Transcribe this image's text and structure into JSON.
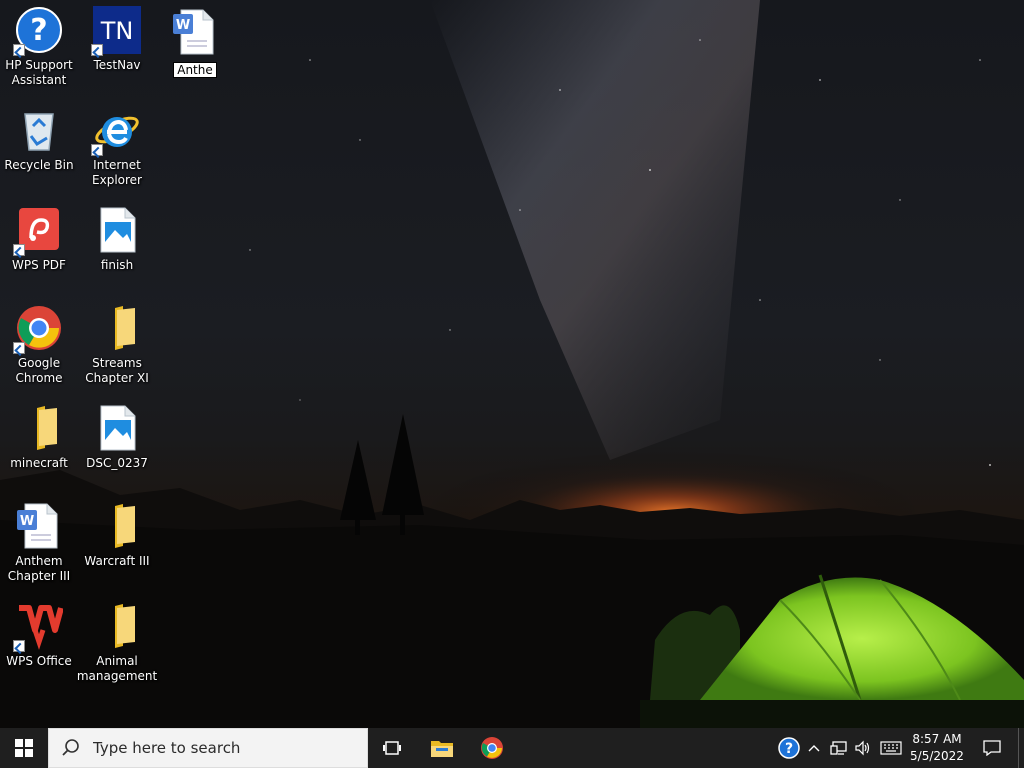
{
  "desktop": {
    "icons": [
      {
        "label": "HP Support\nAssistant",
        "icon": "hp-support-icon"
      },
      {
        "label": "TestNav",
        "icon": "testnav-icon",
        "badge": "TN"
      },
      {
        "label": "Recycle Bin",
        "icon": "recycle-bin-icon"
      },
      {
        "label": "Internet\nExplorer",
        "icon": "internet-explorer-icon"
      },
      {
        "label": "WPS PDF",
        "icon": "wps-pdf-icon"
      },
      {
        "label": "finish",
        "icon": "image-file-icon"
      },
      {
        "label": "Google\nChrome",
        "icon": "chrome-icon"
      },
      {
        "label": "Streams\nChapter XI",
        "icon": "folder-icon"
      },
      {
        "label": "minecraft",
        "icon": "folder-icon"
      },
      {
        "label": "DSC_0237",
        "icon": "image-file-icon"
      },
      {
        "label": "Anthem\nChapter III",
        "icon": "word-document-icon"
      },
      {
        "label": "Warcraft III",
        "icon": "folder-icon"
      },
      {
        "label": "WPS Office",
        "icon": "wps-office-icon"
      },
      {
        "label": "Animal\nmanagement",
        "icon": "folder-icon"
      }
    ],
    "renaming_icon": {
      "icon": "word-document-icon",
      "edit_value": "Anthe"
    }
  },
  "taskbar": {
    "search_placeholder": "Type here to search",
    "pinned": [
      "task-view-icon",
      "file-explorer-icon",
      "chrome-icon"
    ],
    "tray": [
      "hp-support-tray-icon",
      "chevron-up-icon",
      "network-icon",
      "volume-icon",
      "keyboard-icon"
    ],
    "clock_time": "8:57 AM",
    "clock_date": "5/5/2022"
  },
  "colors": {
    "taskbar_bg": "#1f1f1f",
    "tent_green": "#8bd62a",
    "sky_glow": "#e2621b"
  }
}
